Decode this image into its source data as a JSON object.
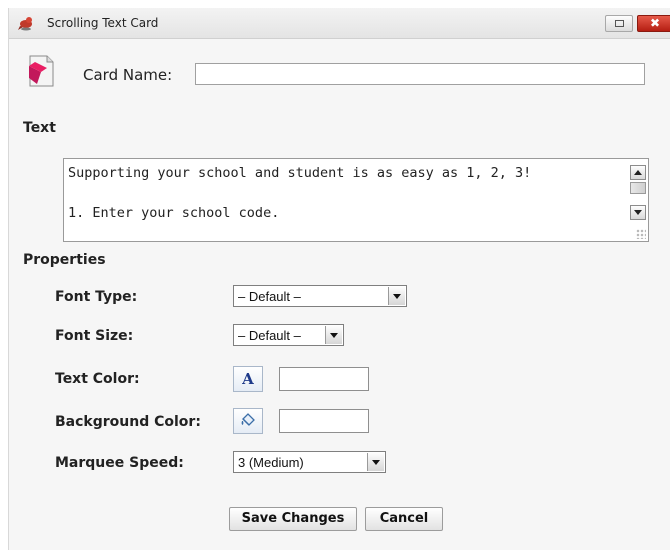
{
  "window": {
    "title": "Scrolling Text Card",
    "close_glyph": "✖",
    "icons": {
      "app": "cardinal-bird-icon",
      "restore": "restore-icon",
      "close": "close-icon"
    }
  },
  "card": {
    "icon": "card-page-icon",
    "name_label": "Card Name:",
    "name_value": ""
  },
  "text_section": {
    "heading": "Text",
    "content": "Supporting your school and student is as easy as 1, 2, 3!\n\n1. Enter your school code."
  },
  "properties": {
    "heading": "Properties",
    "font_type": {
      "label": "Font Type:",
      "value": "– Default –"
    },
    "font_size": {
      "label": "Font Size:",
      "value": "– Default –"
    },
    "text_color": {
      "label": "Text Color:",
      "button_glyph": "A",
      "value": ""
    },
    "background_color": {
      "label": "Background Color:",
      "button_icon": "paint-bucket-icon",
      "value": ""
    },
    "marquee_speed": {
      "label": "Marquee Speed:",
      "value": "3 (Medium)"
    }
  },
  "actions": {
    "save_label": "Save Changes",
    "cancel_label": "Cancel"
  }
}
